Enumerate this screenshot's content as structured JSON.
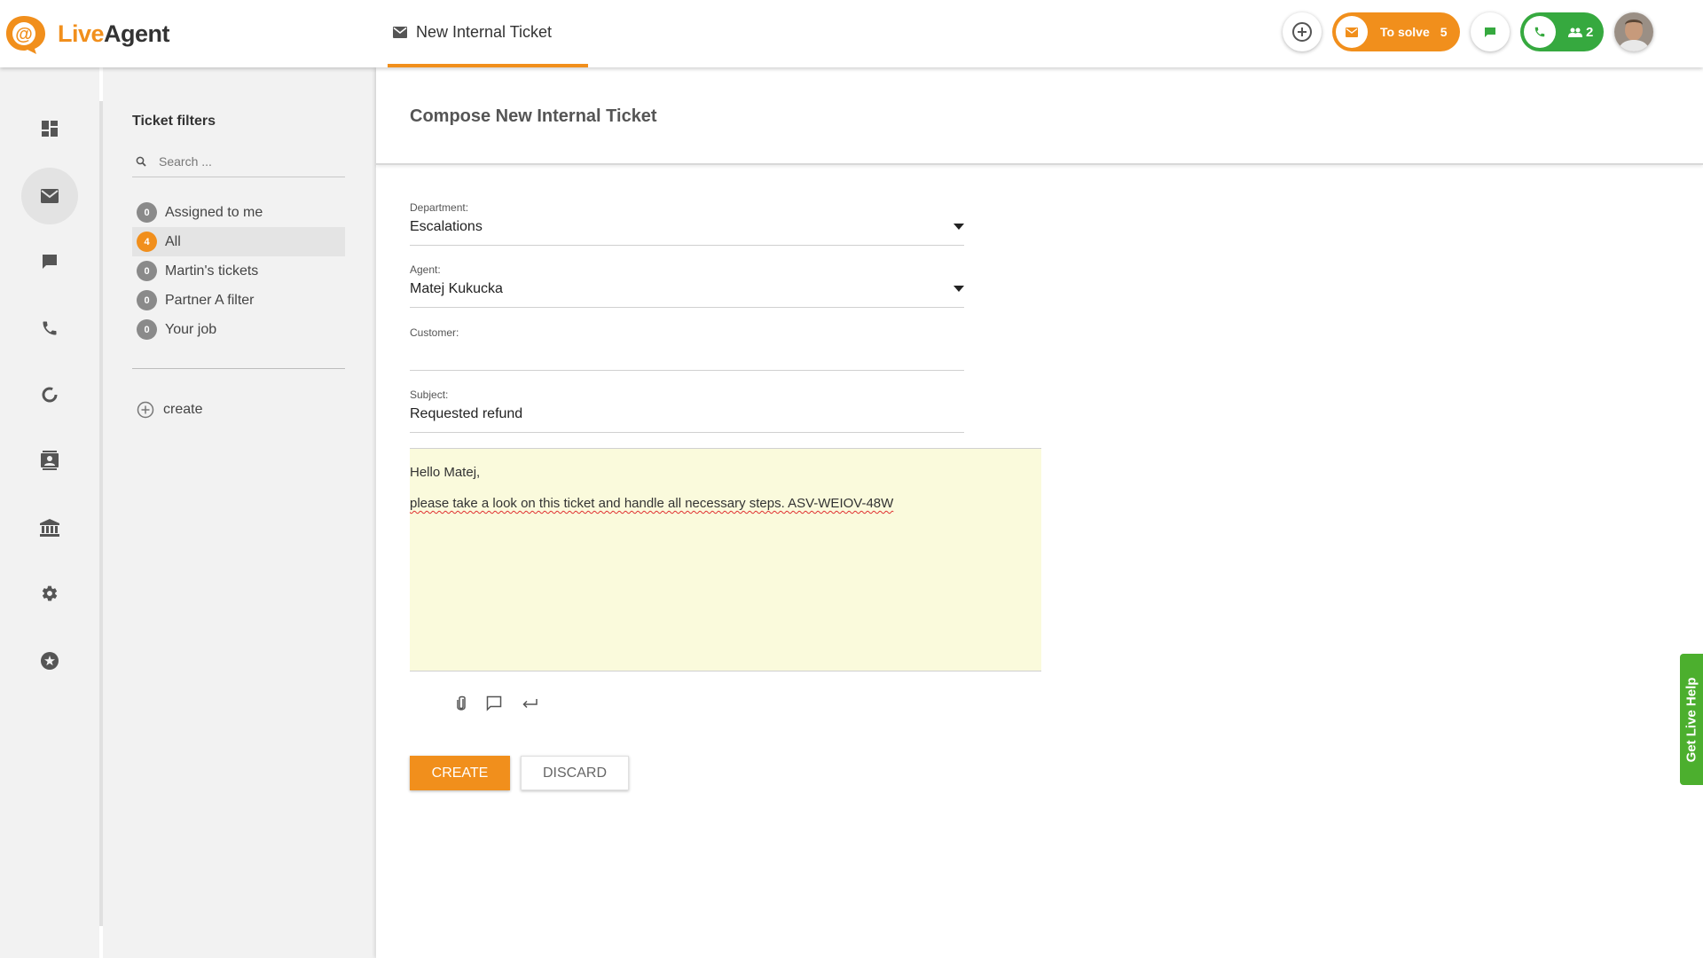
{
  "app": {
    "logo_live": "Live",
    "logo_agent": "Agent"
  },
  "header": {
    "tab_label": "New Internal Ticket",
    "to_solve_label": "To solve",
    "to_solve_count": "5",
    "calls_count": "2"
  },
  "filters": {
    "title": "Ticket filters",
    "search_placeholder": "Search ...",
    "items": [
      {
        "count": "0",
        "label": "Assigned to me",
        "selected": false
      },
      {
        "count": "4",
        "label": "All",
        "selected": true
      },
      {
        "count": "0",
        "label": "Martin's tickets",
        "selected": false
      },
      {
        "count": "0",
        "label": "Partner A filter",
        "selected": false
      },
      {
        "count": "0",
        "label": "Your job",
        "selected": false
      }
    ],
    "create_label": "create"
  },
  "compose": {
    "title": "Compose New Internal Ticket",
    "department_label": "Department:",
    "department_value": "Escalations",
    "agent_label": "Agent:",
    "agent_value": "Matej Kukucka",
    "customer_label": "Customer:",
    "customer_value": "",
    "subject_label": "Subject:",
    "subject_value": "Requested refund",
    "body_line1": "Hello Matej,",
    "body_line2": "please take a look on this ticket and handle all necessary steps. ASV-WEIOV-48W",
    "create_label": "CREATE",
    "discard_label": "DISCARD"
  },
  "live_help": "Get Live Help",
  "colors": {
    "accent_orange": "#f18f1c",
    "accent_green": "#36a93f",
    "editor_bg": "#fafadc"
  }
}
